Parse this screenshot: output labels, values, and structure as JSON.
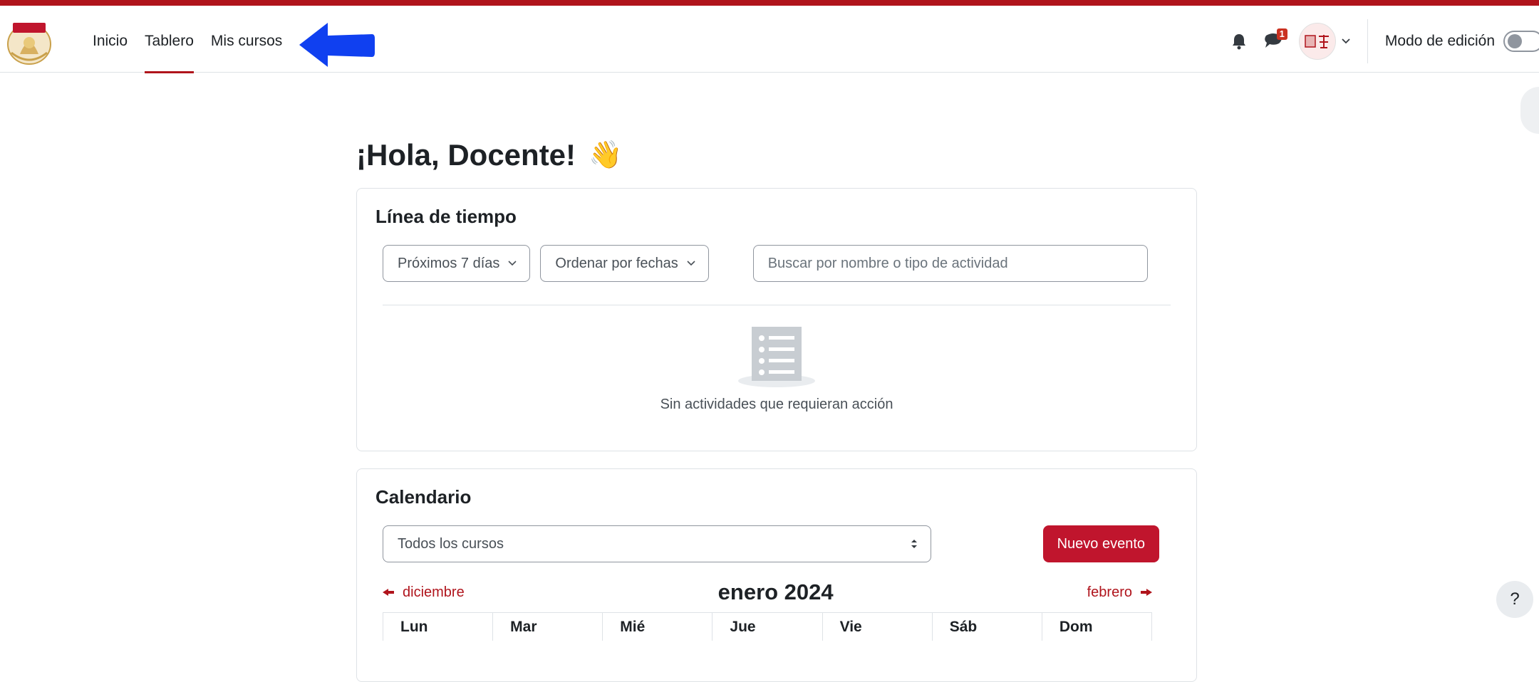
{
  "nav": {
    "links": [
      {
        "label": "Inicio",
        "active": false
      },
      {
        "label": "Tablero",
        "active": true
      },
      {
        "label": "Mis cursos",
        "active": false
      }
    ],
    "messages_badge": "1",
    "edit_mode_label": "Modo de edición"
  },
  "main": {
    "greeting": "¡Hola, Docente!",
    "greeting_emoji": "👋"
  },
  "timeline": {
    "title": "Línea de tiempo",
    "filter_days": "Próximos 7 días",
    "sort_by": "Ordenar por fechas",
    "search_placeholder": "Buscar por nombre o tipo de actividad",
    "empty_text": "Sin actividades que requieran acción"
  },
  "calendar": {
    "title": "Calendario",
    "course_filter": "Todos los cursos",
    "new_event_label": "Nuevo evento",
    "prev_month": "diciembre",
    "current_month": "enero 2024",
    "next_month": "febrero",
    "weekdays": [
      "Lun",
      "Mar",
      "Mié",
      "Jue",
      "Vie",
      "Sáb",
      "Dom"
    ]
  },
  "help_label": "?",
  "colors": {
    "brand": "#b0141c",
    "button": "#c0152d",
    "arrow": "#1040f0"
  },
  "icons": [
    "logo",
    "bell-icon",
    "chat-icon",
    "avatar",
    "chevron-down-icon",
    "toggle",
    "list-icon",
    "arrow-left-icon"
  ]
}
